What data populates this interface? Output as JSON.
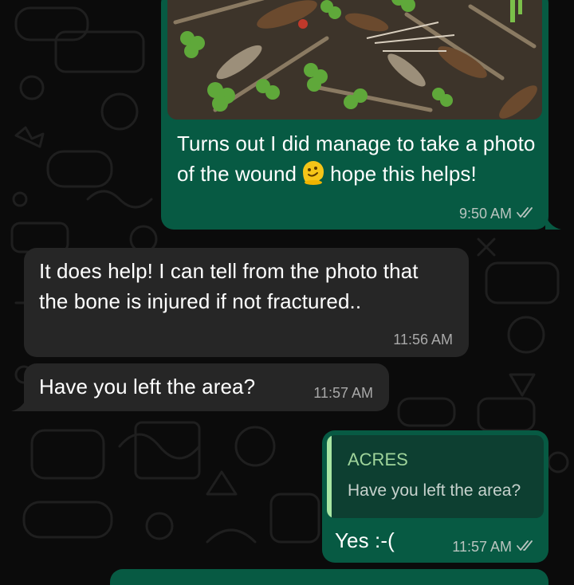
{
  "colors": {
    "outgoing_bubble": "#075a43",
    "incoming_bubble": "#262626",
    "background": "#0b0b0b",
    "read_ticks": "#b9c4bf",
    "quote_accent": "#a8e6a3"
  },
  "messages": [
    {
      "direction": "outgoing",
      "has_photo": true,
      "text": "Turns out I did manage to take a photo of the wound",
      "emoji": "melting-face",
      "text_after_emoji": "hope this helps!",
      "time": "9:50 AM",
      "status": "read"
    },
    {
      "direction": "incoming",
      "text": "It does help! I can tell from the photo that the bone is injured if not fractured..",
      "time": "11:56 AM"
    },
    {
      "direction": "incoming",
      "text": "Have you left the area?",
      "time": "11:57 AM"
    },
    {
      "direction": "outgoing",
      "reply_to": {
        "author": "ACRES",
        "text": "Have you left the area?"
      },
      "text": "Yes :-(",
      "time": "11:57 AM",
      "status": "read"
    }
  ]
}
